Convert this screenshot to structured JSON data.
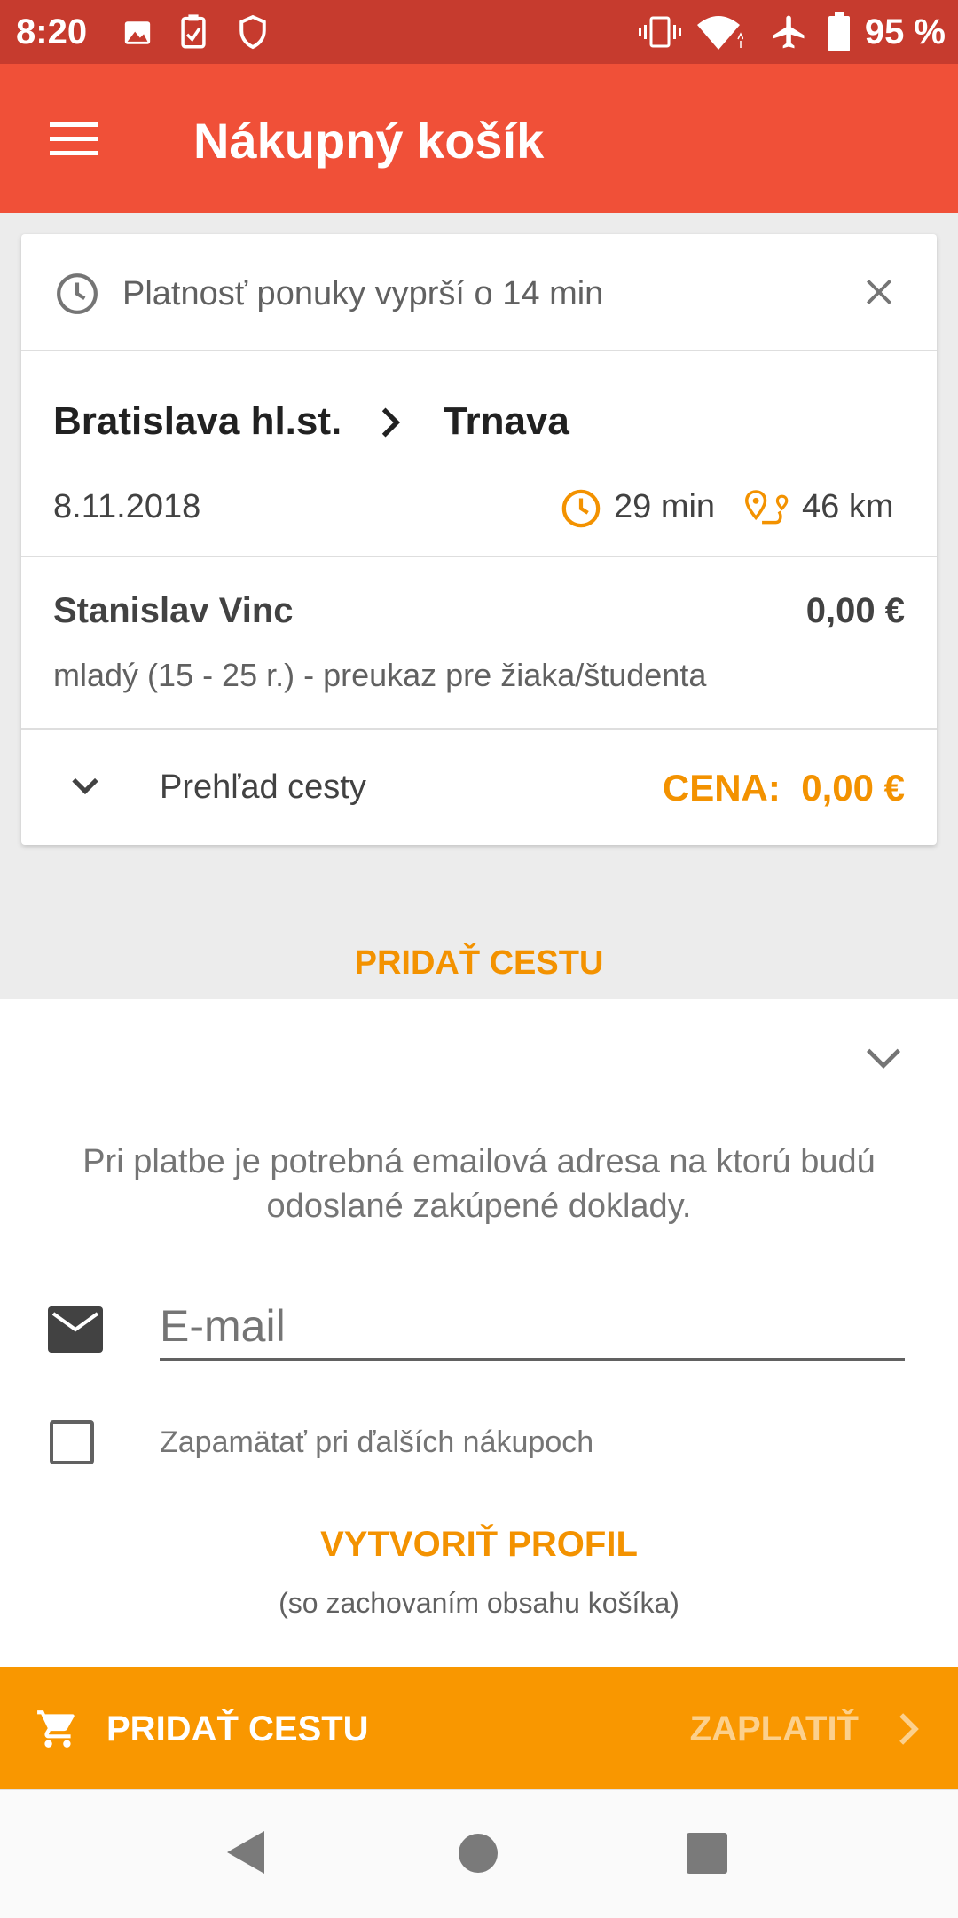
{
  "status_bar": {
    "time": "8:20",
    "battery": "95 %"
  },
  "app_bar": {
    "title": "Nákupný košík"
  },
  "offer": {
    "validity": "Platnosť ponuky vyprší o 14 min"
  },
  "route": {
    "from": "Bratislava hl.st.",
    "to": "Trnava",
    "date": "8.11.2018",
    "duration": "29 min",
    "distance": "46 km"
  },
  "passenger": {
    "name": "Stanislav Vinc",
    "price": "0,00 €",
    "tariff": "mladý (15 - 25 r.) - preukaz pre žiaka/študenta"
  },
  "overview": {
    "label": "Prehľad cesty",
    "price_label": "CENA:",
    "price": "0,00 €"
  },
  "add_route_link": "PRIDAŤ CESTU",
  "payment": {
    "info": "Pri platbe je potrebná emailová adresa na ktorú budú odoslané zakúpené doklady.",
    "email_placeholder": "E-mail",
    "email_value": "",
    "remember_label": "Zapamätať pri ďalších nákupoch",
    "remember_checked": false,
    "create_profile": "VYTVORIŤ PROFIL",
    "create_profile_note": "(so zachovaním obsahu košíka)"
  },
  "action_bar": {
    "add_route": "PRIDAŤ CESTU",
    "pay": "ZAPLATIŤ"
  },
  "colors": {
    "appbar": "#f05038",
    "statusbar": "#c63b2e",
    "accent": "#f39200",
    "actionbar": "#f99700"
  },
  "icons": [
    "image-icon",
    "checklist-icon",
    "shield-icon",
    "vibrate-icon",
    "wifi-icon",
    "airplane-icon",
    "battery-icon",
    "menu-icon",
    "clock-icon",
    "close-icon",
    "chevron-right-icon",
    "route-icon",
    "chevron-down-icon",
    "mail-icon",
    "checkbox-icon",
    "cart-icon",
    "back-icon",
    "home-icon",
    "recents-icon"
  ]
}
